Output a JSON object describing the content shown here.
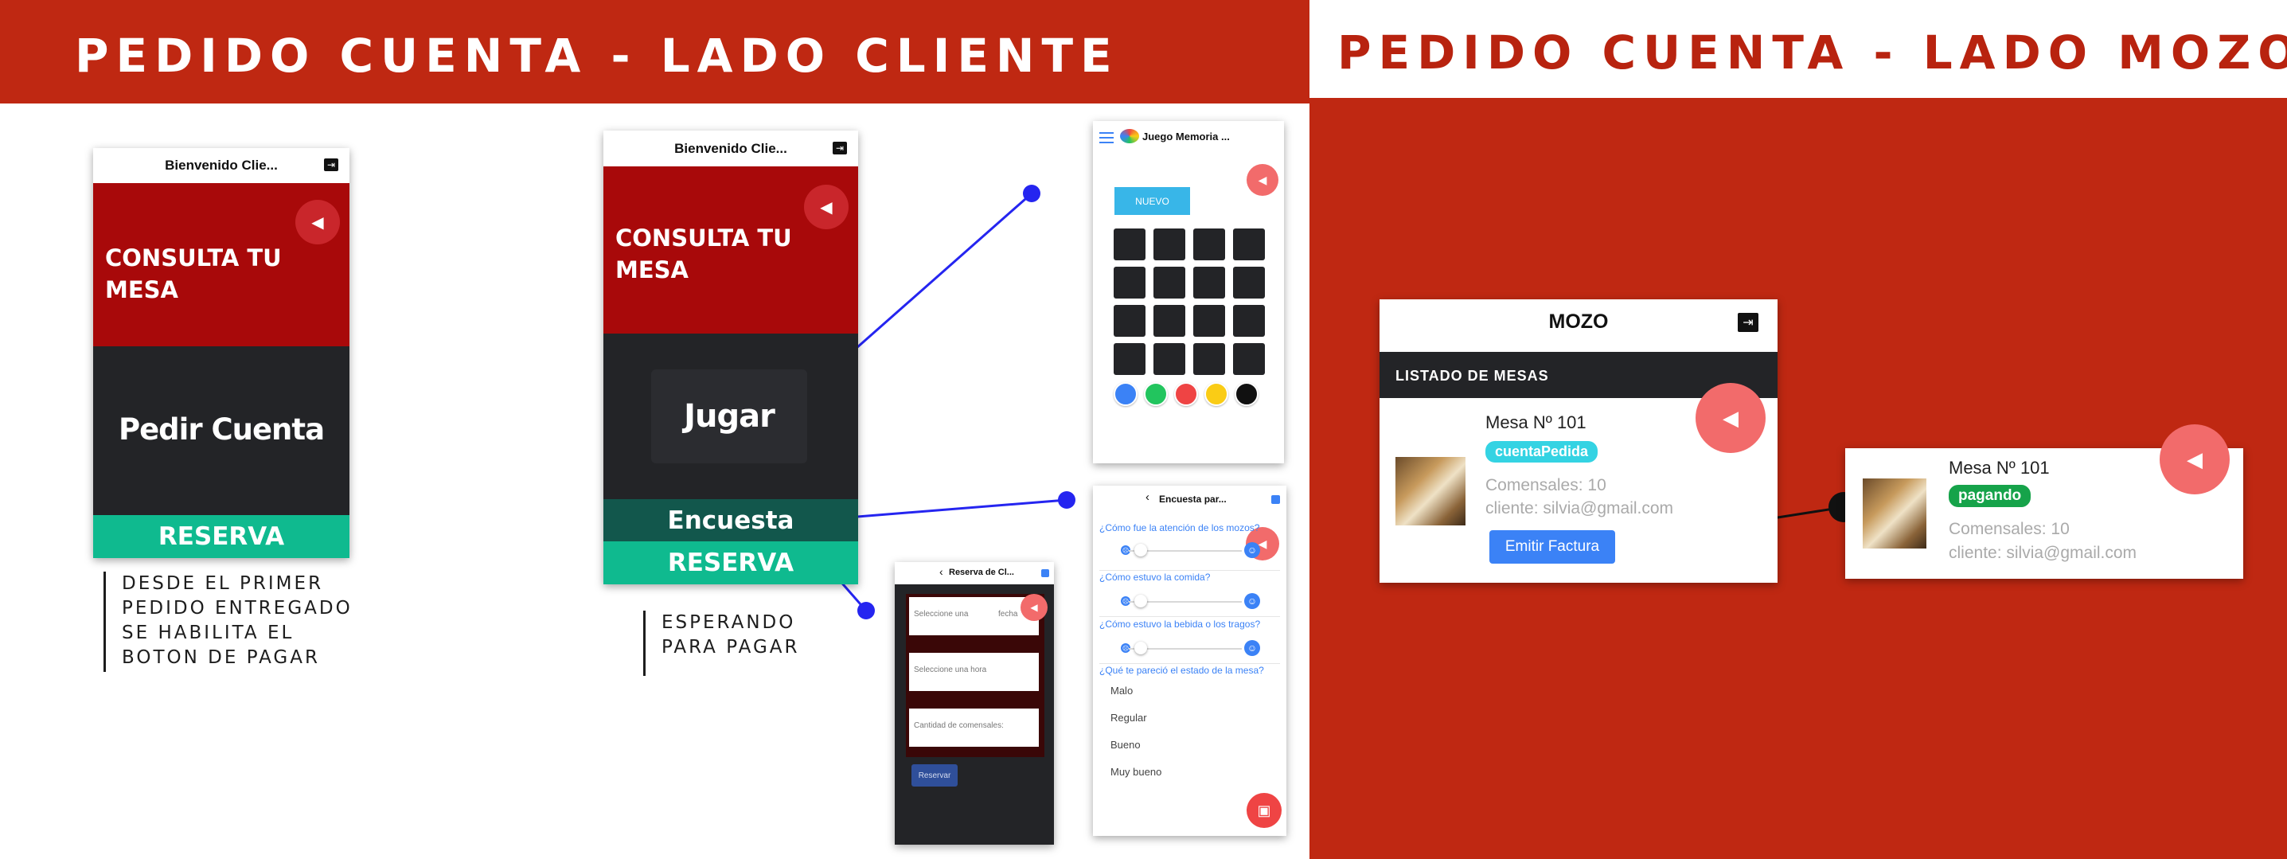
{
  "header": {
    "left_title": "PEDIDO CUENTA  - LADO CLIENTE",
    "right_title": "PEDIDO CUENTA  - LADO MOZO"
  },
  "colors": {
    "brand_red": "#b8230f",
    "dark_red": "#a8090a",
    "dark": "#232427",
    "teal": "#0fba8f",
    "dark_teal": "#12574c",
    "blue_line": "#2525f0",
    "accent_blue": "#3b82f6"
  },
  "phone1": {
    "title": "Bienvenido Clie...",
    "hero": "CONSULTA TU MESA",
    "main_button": "Pedir Cuenta",
    "reserve_button": "RESERVA",
    "note": [
      "DESDE EL PRIMER",
      "PEDIDO ENTREGADO",
      "SE HABILITA EL",
      "BOTON DE PAGAR"
    ]
  },
  "phone2": {
    "title": "Bienvenido Clie...",
    "hero": "CONSULTA TU MESA",
    "game_button": "Jugar",
    "survey_button": "Encuesta",
    "reserve_button": "RESERVA",
    "note": [
      "ESPERANDO",
      "PARA PAGAR"
    ]
  },
  "memory_game": {
    "title": "Juego Memoria ...",
    "new_button": "NUEVO",
    "grid": {
      "rows": 4,
      "cols": 4
    },
    "dot_colors": [
      "#3b82f6",
      "#22c55e",
      "#ef4444",
      "#facc15",
      "#111111"
    ]
  },
  "survey": {
    "title": "Encuesta par...",
    "questions": [
      "¿Cómo fue la atención de los mozos?",
      "¿Cómo estuvo la comida?",
      "¿Cómo estuvo la bebida o los tragos?",
      "¿Qué te pareció el estado de la mesa?"
    ],
    "options": [
      "Malo",
      "Regular",
      "Bueno",
      "Muy bueno"
    ]
  },
  "reservation": {
    "title": "Reserva de Cl...",
    "date_placeholder": "Seleccione una",
    "date_suffix": "fecha",
    "time_placeholder": "Seleccione una hora",
    "guests_placeholder": "Cantidad de comensales:",
    "submit_button": "Reservar"
  },
  "mozo": {
    "title": "MOZO",
    "list_header": "LISTADO DE MESAS",
    "table": "Mesa Nº 101",
    "status": "cuentaPedida",
    "guests": "Comensales: 10",
    "client": "cliente: silvia@gmail.com",
    "action_button": "Emitir Factura"
  },
  "mozo_result": {
    "table": "Mesa Nº 101",
    "status": "pagando",
    "guests": "Comensales: 10",
    "client": "cliente: silvia@gmail.com"
  },
  "icons": {
    "exit": "exit-icon",
    "sound": "speaker-icon",
    "menu": "hamburger-menu-icon",
    "back": "chevron-left-icon",
    "camera": "camera-icon"
  }
}
